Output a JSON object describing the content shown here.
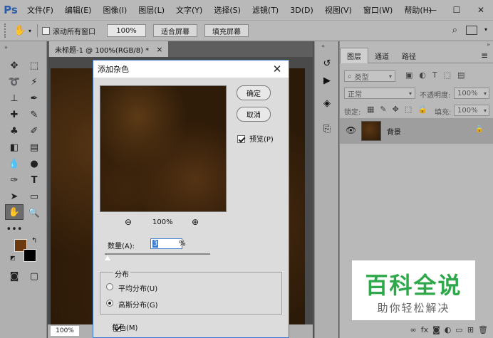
{
  "app": {
    "logo": "Ps"
  },
  "menu": [
    "文件(F)",
    "编辑(E)",
    "图像(I)",
    "图层(L)",
    "文字(Y)",
    "选择(S)",
    "滤镜(T)",
    "3D(D)",
    "视图(V)",
    "窗口(W)",
    "帮助(H)"
  ],
  "window_controls": {
    "minimize": "—",
    "maximize": "☐",
    "close": "✕"
  },
  "options": {
    "scroll_all_label": "滚动所有窗口",
    "scroll_all_checked": false,
    "zoom_value": "100%",
    "fit_screen": "适合屏幕",
    "fill_screen": "填充屏幕"
  },
  "document": {
    "tab_title": "未标题-1 @ 100%(RGB/8) *",
    "tab_close": "×",
    "zoom": "100%"
  },
  "panel": {
    "tabs": [
      "图层",
      "通道",
      "路径"
    ],
    "active_tab": "图层",
    "filter_kind": "类型",
    "blend_mode": "正常",
    "opacity_label": "不透明度:",
    "opacity_value": "100%",
    "lock_label": "锁定:",
    "fill_label": "填充:",
    "fill_value": "100%",
    "layer_name": "背景"
  },
  "dialog": {
    "title": "添加杂色",
    "close": "✕",
    "ok": "确定",
    "cancel": "取消",
    "preview_label": "预览(P)",
    "preview_checked": true,
    "zoom_level": "100%",
    "amount_label": "数量(A):",
    "amount_value": "3",
    "amount_unit": "%",
    "distribution_label": "分布",
    "uniform_label": "平均分布(U)",
    "gaussian_label": "高斯分布(G)",
    "selected_distribution": "gaussian",
    "mono_label": "单色(M)",
    "mono_checked": true
  },
  "watermark": {
    "title": "百科全说",
    "subtitle": "助你轻松解决"
  },
  "colors": {
    "foreground": "#6b3a10",
    "background": "#000000",
    "accent": "#3b7bd0"
  }
}
